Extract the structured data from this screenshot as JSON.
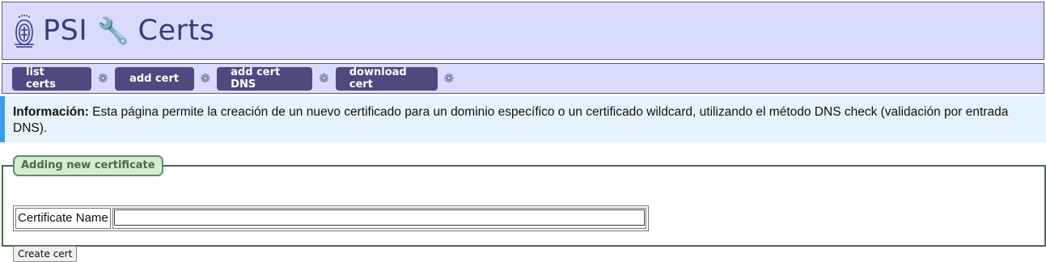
{
  "header": {
    "logo_icon": "university-seal-icon",
    "title_left": "PSI",
    "title_icon": "wrench-icon",
    "title_right": "Certs"
  },
  "nav": {
    "items": [
      {
        "label": "list certs"
      },
      {
        "label": "add cert"
      },
      {
        "label": "add cert DNS"
      },
      {
        "label": "download cert"
      }
    ],
    "separator": "❁"
  },
  "info": {
    "label": "Información:",
    "text": " Esta página permite la creación de un nuevo certificado para un dominio específico o un certificado wildcard, utilizando el método DNS check (validación por entrada DNS)."
  },
  "form": {
    "legend": "Adding new certificate",
    "name_label": "Certificate Name",
    "name_value": "",
    "submit_label": "Create cert"
  },
  "colors": {
    "header_bg": "#d9dbfc",
    "nav_button": "#4d4a80",
    "info_bg": "#e6f3fd",
    "info_border": "#3d9be9",
    "fieldset_border": "#486a48"
  }
}
